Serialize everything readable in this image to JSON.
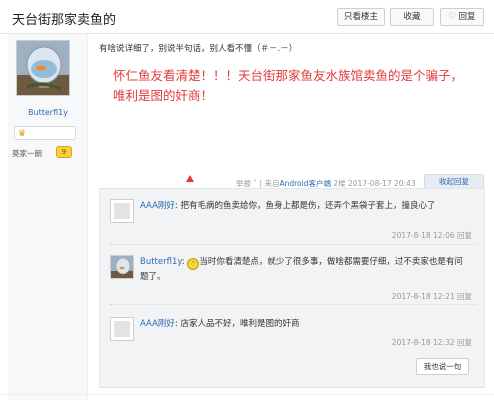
{
  "header": {
    "title": "天台街那家卖鱼的",
    "buttons": [
      {
        "label": "只看楼主"
      },
      {
        "label": "收藏"
      },
      {
        "label": "回复",
        "icon": "heart-icon"
      }
    ]
  },
  "author": {
    "username": "Butterfl1y",
    "level_label": "莫家一朗",
    "level_badge": "9"
  },
  "post": {
    "intro": "有啥说详细了，别说半句话，别人看不懂（＃－.－）",
    "body": "怀仁鱼友看清楚！！！天台街那家鱼友水族馆卖鱼的是个骗子，唯利是图的奸商！",
    "meta": {
      "report": "举报",
      "source_prefix": "来自",
      "source": "Android客户端",
      "floor": "2楼",
      "time": "2017-08-17 20:43",
      "collapse": "收起回复"
    }
  },
  "replies": [
    {
      "name": "AAA刚好",
      "text": "把有毛病的鱼卖给你，鱼身上都是伤，还弄个黑袋子套上，撞良心了",
      "time": "2017-8-18 12:06",
      "reply_label": "回复"
    },
    {
      "name": "Butterfl1y",
      "text": "当时你看清楚点，就少了很多事，做啥都需要仔细，过不卖家也是有问题了。",
      "time": "2017-8-18 12:21",
      "reply_label": "回复"
    },
    {
      "name": "AAA刚好",
      "text": "店家人品不好，唯利是图的奸商",
      "time": "2017-8-18 12:32",
      "reply_label": "回复"
    }
  ],
  "say_button": "我也说一句",
  "colors": {
    "accent_blue": "#2b6cb0",
    "highlight_red": "#e23b3b",
    "reply_bg": "#f2f3f5"
  }
}
